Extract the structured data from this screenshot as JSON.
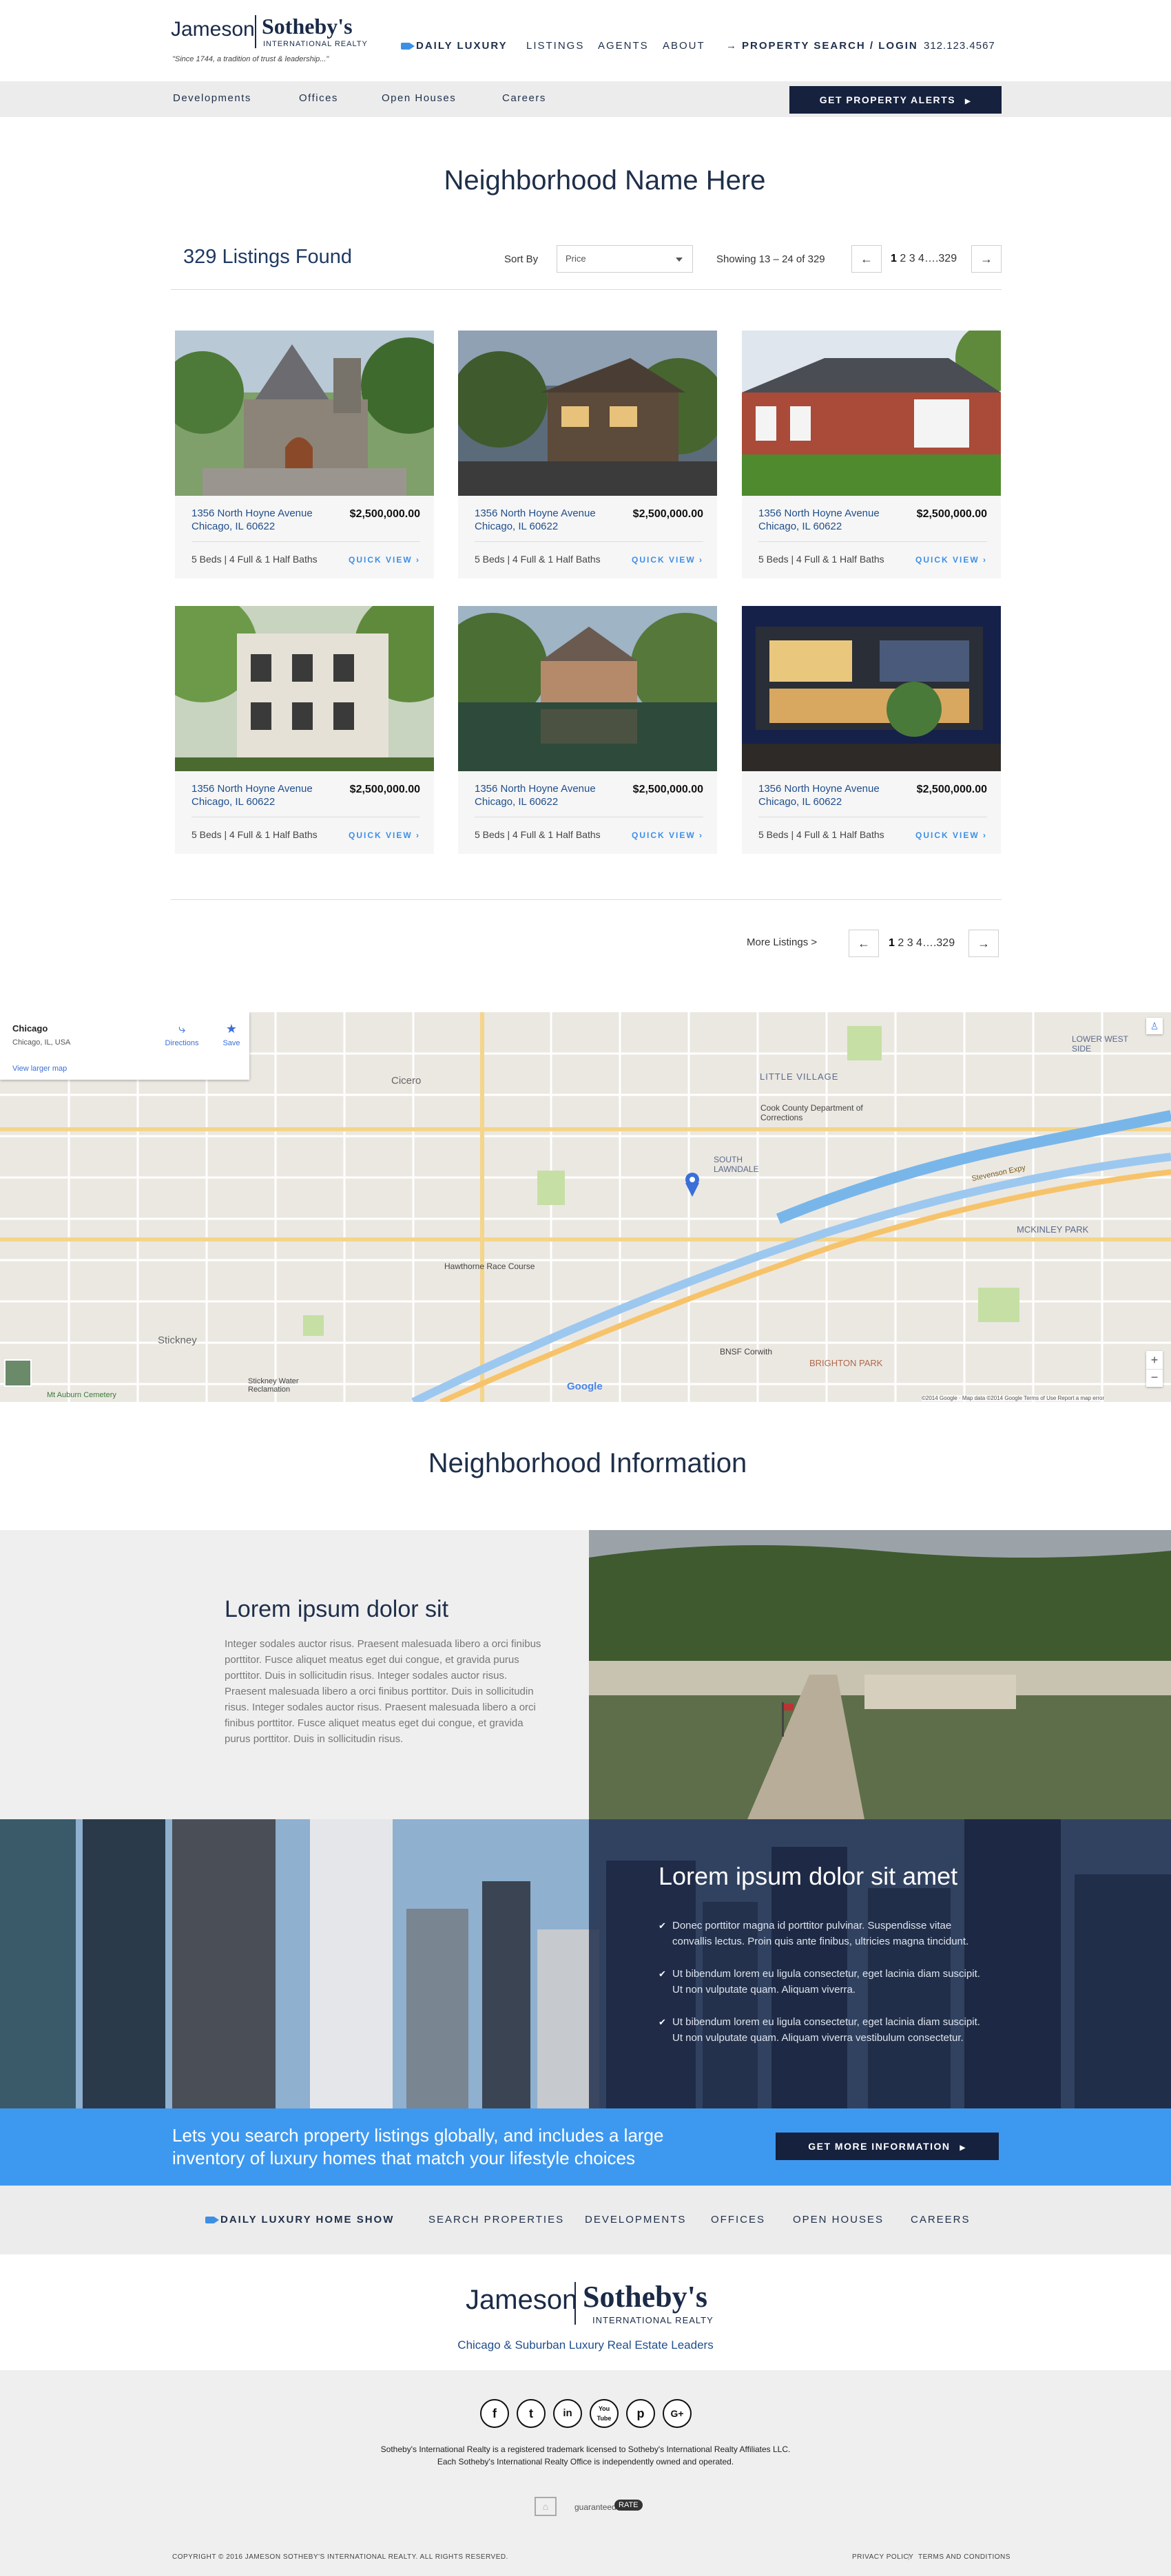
{
  "brand": {
    "name_left": "Jameson",
    "name_right": "Sotheby's",
    "sub": "INTERNATIONAL REALTY",
    "tagline": "\"Since 1744, a tradition of trust & leadership...\""
  },
  "topnav": {
    "daily": "DAILY LUXURY",
    "listings": "LISTINGS",
    "agents": "AGENTS",
    "about": "ABOUT",
    "search": "PROPERTY SEARCH / LOGIN",
    "phone": "312.123.4567"
  },
  "subnav": {
    "items": [
      "Developments",
      "Offices",
      "Open Houses",
      "Careers"
    ],
    "alerts": "GET PROPERTY ALERTS"
  },
  "page_title": "Neighborhood Name Here",
  "results": {
    "found": "329 Listings Found",
    "sort_label": "Sort By",
    "sort_value": "Price",
    "showing": "Showing 13 – 24 of 329",
    "pages": "1 2 3 4…329",
    "page_current": "1",
    "page_rest": "2  3  4….329",
    "more": "More Listings  >"
  },
  "listings": [
    {
      "street": "1356 North Hoyne Avenue",
      "city": "Chicago, IL 60622",
      "price": "$2,500,000.00",
      "beds": "5 Beds  |  4 Full & 1 Half Baths",
      "quick": "QUICK VIEW ›"
    },
    {
      "street": "1356 North Hoyne Avenue",
      "city": "Chicago, IL 60622",
      "price": "$2,500,000.00",
      "beds": "5 Beds  |  4 Full & 1 Half Baths",
      "quick": "QUICK VIEW ›"
    },
    {
      "street": "1356 North Hoyne Avenue",
      "city": "Chicago, IL 60622",
      "price": "$2,500,000.00",
      "beds": "5 Beds  |  4 Full & 1 Half Baths",
      "quick": "QUICK VIEW ›"
    },
    {
      "street": "1356 North Hoyne Avenue",
      "city": "Chicago, IL 60622",
      "price": "$2,500,000.00",
      "beds": "5 Beds  |  4 Full & 1 Half Baths",
      "quick": "QUICK VIEW ›"
    },
    {
      "street": "1356 North Hoyne Avenue",
      "city": "Chicago, IL 60622",
      "price": "$2,500,000.00",
      "beds": "5 Beds  |  4 Full & 1 Half Baths",
      "quick": "QUICK VIEW ›"
    },
    {
      "street": "1356 North Hoyne Avenue",
      "city": "Chicago, IL 60622",
      "price": "$2,500,000.00",
      "beds": "5 Beds  |  4 Full & 1 Half Baths",
      "quick": "QUICK VIEW ›"
    }
  ],
  "map": {
    "place": "Chicago",
    "place_sub": "Chicago, IL, USA",
    "directions": "Directions",
    "save": "Save",
    "larger": "View larger map",
    "labels": {
      "little_village": "LITTLE VILLAGE",
      "lower_west": "LOWER WEST SIDE",
      "south_lawndale": "SOUTH LAWNDALE",
      "mckinley": "MCKINLEY PARK",
      "brighton": "BRIGHTON PARK",
      "cicero": "Cicero",
      "stickney": "Stickney",
      "hawthorne": "Hawthorne Race Course",
      "cook_county": "Cook County Department of Corrections",
      "bnsf": "BNSF Corwith",
      "water": "Stickney Water Reclamation",
      "cemetery": "Mt Auburn Cemetery",
      "stevenson": "Stevenson Expy",
      "google": "Google",
      "attrib": "©2014 Google · Map data ©2014 Google   Terms of Use   Report a map error"
    }
  },
  "neighborhood": {
    "title": "Neighborhood Information",
    "block1_title": "Lorem ipsum dolor sit",
    "block1_text": "Integer sodales auctor risus. Praesent malesuada libero a orci finibus porttitor. Fusce aliquet meatus eget dui congue, et gravida purus porttitor. Duis in sollicitudin risus. Integer sodales auctor risus. Praesent malesuada libero a orci finibus porttitor.  Duis in sollicitudin risus. Integer sodales auctor risus. Praesent malesuada libero a orci finibus porttitor. Fusce aliquet meatus eget dui congue, et gravida purus porttitor. Duis in sollicitudin risus.",
    "block2_title": "Lorem ipsum dolor sit amet",
    "block2_items": [
      "Donec porttitor magna id porttitor pulvinar. Suspendisse vitae convallis lectus. Proin quis ante finibus, ultricies magna tincidunt.",
      "Ut bibendum lorem eu ligula consectetur, eget lacinia diam suscipit. Ut non vulputate quam. Aliquam viverra.",
      "Ut bibendum lorem eu ligula consectetur, eget lacinia diam suscipit. Ut non vulputate quam. Aliquam viverra vestibulum consectetur."
    ]
  },
  "cta": {
    "text": "Lets you search property listings globally, and includes a large inventory of luxury homes that match your lifestyle choices",
    "button": "GET MORE INFORMATION"
  },
  "footer": {
    "nav": [
      "DAILY LUXURY HOME SHOW",
      "SEARCH PROPERTIES",
      "DEVELOPMENTS",
      "OFFICES",
      "OPEN HOUSES",
      "CAREERS"
    ],
    "tagline": "Chicago & Suburban Luxury Real Estate Leaders",
    "social": [
      "f",
      "t",
      "in",
      "You Tube",
      "p",
      "G+"
    ],
    "legal1": "Sotheby's International Realty is a registered trademark licensed to Sotheby's International Realty Affiliates LLC.",
    "legal2": "Each Sotheby's International Realty Office is independently owned and operated.",
    "guaranteed": "guaranteed",
    "guaranteed_badge": "RATE",
    "copyright": "COPYRIGHT © 2016 JAMESON SOTHEBY'S INTERNATIONAL REALTY. ALL RIGHTS RESERVED.",
    "privacy": "PRIVACY POLICY",
    "terms": "TERMS AND CONDITIONS"
  }
}
